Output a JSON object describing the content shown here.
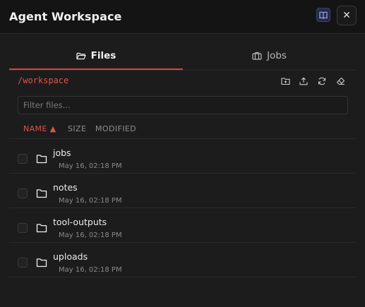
{
  "header": {
    "title": "Agent Workspace",
    "close_label": "✕"
  },
  "tabs": [
    {
      "label": "Files",
      "active": true
    },
    {
      "label": "Jobs",
      "active": false
    }
  ],
  "path": "/workspace",
  "toolbar_icons": [
    "new-folder-icon",
    "upload-icon",
    "refresh-icon",
    "eraser-icon"
  ],
  "filter": {
    "placeholder": "Filter files...",
    "value": ""
  },
  "columns": {
    "name": "NAME ▲",
    "size": "SIZE",
    "modified": "MODIFIED"
  },
  "files": [
    {
      "name": "jobs",
      "modified": "May 16, 02:18 PM"
    },
    {
      "name": "notes",
      "modified": "May 16, 02:18 PM"
    },
    {
      "name": "tool-outputs",
      "modified": "May 16, 02:18 PM"
    },
    {
      "name": "uploads",
      "modified": "May 16, 02:18 PM"
    }
  ],
  "colors": {
    "accent": "#d9423c",
    "background": "#1c1c1c",
    "header_bg": "#141414"
  }
}
